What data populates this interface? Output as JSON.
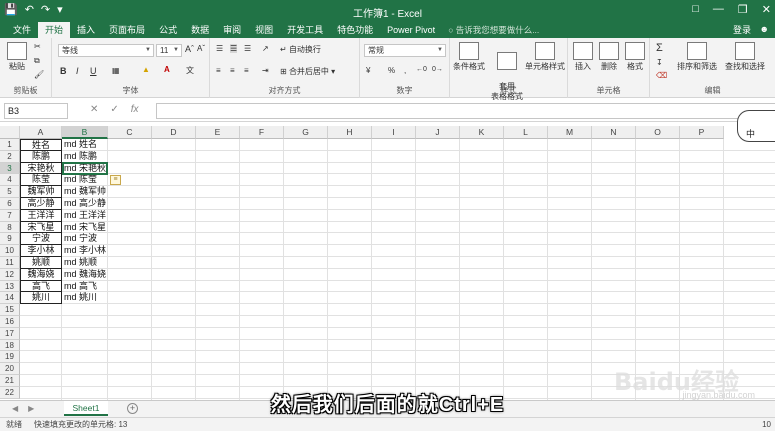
{
  "window": {
    "title": "工作簿1 - Excel",
    "qat_icons": [
      "save-icon",
      "undo-icon",
      "redo-icon",
      "customize-icon"
    ],
    "controls": [
      "minimize",
      "restore",
      "close"
    ]
  },
  "tabs": [
    "文件",
    "开始",
    "插入",
    "页面布局",
    "公式",
    "数据",
    "审阅",
    "视图",
    "开发工具",
    "特色功能",
    "Power Pivot"
  ],
  "active_tab": "开始",
  "tell_me": "告诉我您想要做什么...",
  "login": "登录",
  "ribbon": {
    "clipboard": {
      "label": "剪贴板",
      "paste": "粘贴"
    },
    "font": {
      "label": "字体",
      "name": "等线",
      "size": "11",
      "bold": "B",
      "italic": "I",
      "underline": "U"
    },
    "alignment": {
      "label": "对齐方式",
      "wrap": "自动换行",
      "merge": "合并后居中"
    },
    "number": {
      "label": "数字",
      "format": "常规"
    },
    "styles": {
      "label": "样式",
      "conditional": "条件格式",
      "table": "套用\n表格格式",
      "cell": "单元格样式"
    },
    "cells": {
      "label": "单元格",
      "insert": "插入",
      "delete": "删除",
      "format": "格式"
    },
    "editing": {
      "label": "编辑",
      "sort": "排序和筛选",
      "find": "查找和选择"
    }
  },
  "formula_bar": {
    "name_box": "B3",
    "formula": ""
  },
  "columns": [
    "A",
    "B",
    "C",
    "D",
    "E",
    "F",
    "G",
    "H",
    "I",
    "J",
    "K",
    "L",
    "M",
    "N",
    "O",
    "P"
  ],
  "rows": [
    "1",
    "2",
    "3",
    "4",
    "5",
    "6",
    "7",
    "8",
    "9",
    "10",
    "11",
    "12",
    "13",
    "14",
    "15",
    "16",
    "17",
    "18",
    "19",
    "20",
    "21",
    "22"
  ],
  "cells": [
    {
      "a": "姓名",
      "b": "md 姓名"
    },
    {
      "a": "陈鹏",
      "b": "md 陈鹏"
    },
    {
      "a": "宋艳秋",
      "b": "md 宋艳秋"
    },
    {
      "a": "陈莹",
      "b": "md 陈莹"
    },
    {
      "a": "魏军帅",
      "b": "md 魏军帅"
    },
    {
      "a": "高少静",
      "b": "md 高少静"
    },
    {
      "a": "王洋洋",
      "b": "md 王洋洋"
    },
    {
      "a": "宋飞星",
      "b": "md 宋飞星"
    },
    {
      "a": "宁波",
      "b": "md 宁波"
    },
    {
      "a": "李小林",
      "b": "md 李小林"
    },
    {
      "a": "姚顺",
      "b": "md 姚顺"
    },
    {
      "a": "魏海娆",
      "b": "md 魏海娆"
    },
    {
      "a": "高飞",
      "b": "md 高飞"
    },
    {
      "a": "姚川",
      "b": "md 姚川"
    }
  ],
  "ime": {
    "label": "中"
  },
  "sheet_tab": "Sheet1",
  "status": {
    "ready": "就绪",
    "message": "快速填充更改的单元格: 13",
    "zoom": "10"
  },
  "subtitle": "然后我们后面的就Ctrl+E",
  "watermark": "Baidu经验",
  "watermark_sub": "jingyan.baidu.com",
  "colors": {
    "accent": "#217346"
  }
}
